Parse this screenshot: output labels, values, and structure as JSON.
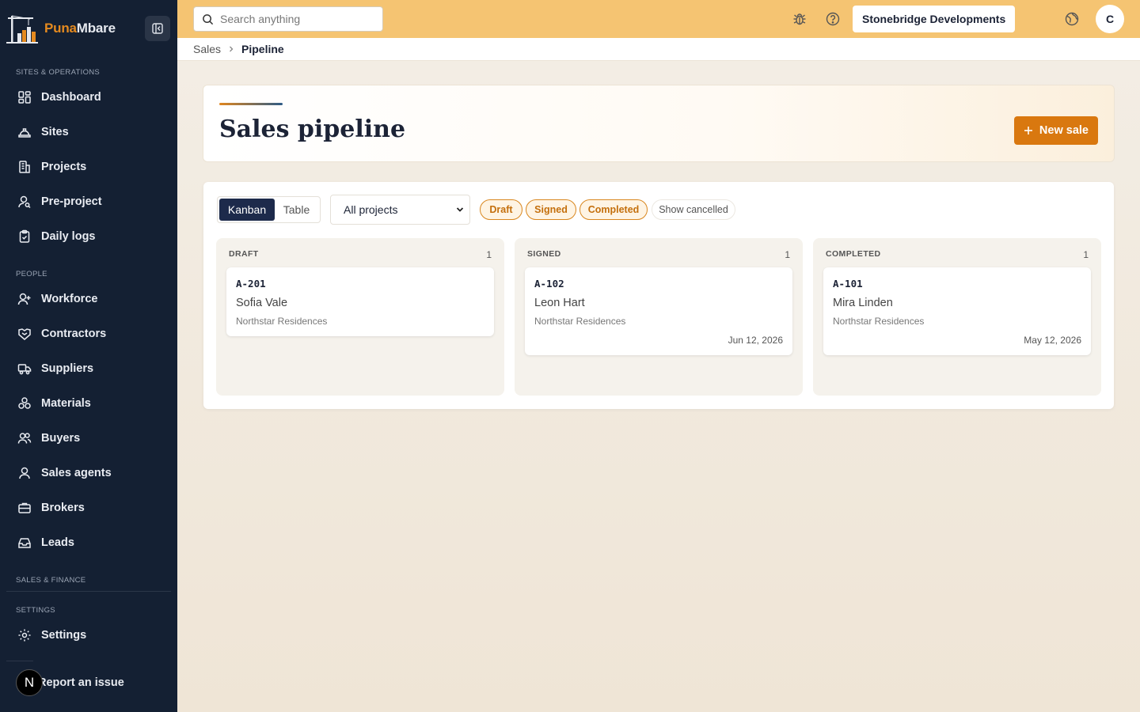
{
  "brand": {
    "name_part1": "Puna",
    "name_part2": "Mbare",
    "accent_color": "#e58a1f"
  },
  "sidebar": {
    "sections": [
      {
        "label": "SITES & OPERATIONS"
      },
      {
        "label": "PEOPLE"
      },
      {
        "label": "SALES & FINANCE"
      },
      {
        "label": "SETTINGS"
      }
    ],
    "items": [
      {
        "label": "Dashboard",
        "icon": "dashboard-icon"
      },
      {
        "label": "Sites",
        "icon": "helmet-icon"
      },
      {
        "label": "Projects",
        "icon": "building-icon"
      },
      {
        "label": "Pre-project",
        "icon": "user-search-icon"
      },
      {
        "label": "Daily logs",
        "icon": "clipboard-icon"
      },
      {
        "label": "Workforce",
        "icon": "user-plus-icon"
      },
      {
        "label": "Contractors",
        "icon": "handshake-icon"
      },
      {
        "label": "Suppliers",
        "icon": "truck-icon"
      },
      {
        "label": "Materials",
        "icon": "boxes-icon"
      },
      {
        "label": "Buyers",
        "icon": "users-icon"
      },
      {
        "label": "Sales agents",
        "icon": "user-icon"
      },
      {
        "label": "Brokers",
        "icon": "briefcase-icon"
      },
      {
        "label": "Leads",
        "icon": "inbox-icon"
      },
      {
        "label": "Settings",
        "icon": "gear-icon"
      }
    ],
    "report_label": "Report an issue",
    "report_avatar": "N"
  },
  "topbar": {
    "search_placeholder": "Search anything",
    "organization": "Stonebridge Developments",
    "user_initial": "C"
  },
  "breadcrumb": {
    "parent": "Sales",
    "current": "Pipeline"
  },
  "page": {
    "title": "Sales pipeline",
    "new_button": "New sale",
    "views": {
      "kanban": "Kanban",
      "table": "Table",
      "active": "Kanban"
    },
    "project_filter": "All projects",
    "status_chips": [
      "Draft",
      "Signed",
      "Completed"
    ],
    "show_cancelled": "Show cancelled"
  },
  "columns": [
    {
      "title": "DRAFT",
      "count": "1",
      "cards": [
        {
          "code": "A-201",
          "buyer": "Sofia Vale",
          "project": "Northstar Residences",
          "date": ""
        }
      ]
    },
    {
      "title": "SIGNED",
      "count": "1",
      "cards": [
        {
          "code": "A-102",
          "buyer": "Leon Hart",
          "project": "Northstar Residences",
          "date": "Jun 12, 2026"
        }
      ]
    },
    {
      "title": "COMPLETED",
      "count": "1",
      "cards": [
        {
          "code": "A-101",
          "buyer": "Mira Linden",
          "project": "Northstar Residences",
          "date": "May 12, 2026"
        }
      ]
    }
  ]
}
